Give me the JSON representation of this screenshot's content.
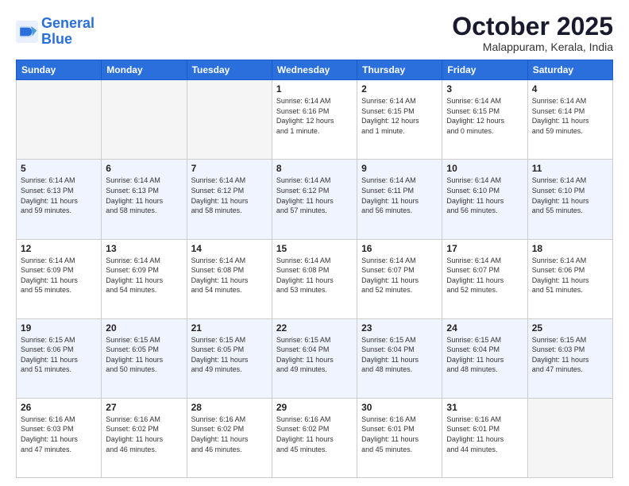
{
  "header": {
    "logo_line1": "General",
    "logo_line2": "Blue",
    "month": "October 2025",
    "location": "Malappuram, Kerala, India"
  },
  "days_of_week": [
    "Sunday",
    "Monday",
    "Tuesday",
    "Wednesday",
    "Thursday",
    "Friday",
    "Saturday"
  ],
  "weeks": [
    [
      {
        "day": "",
        "info": ""
      },
      {
        "day": "",
        "info": ""
      },
      {
        "day": "",
        "info": ""
      },
      {
        "day": "1",
        "info": "Sunrise: 6:14 AM\nSunset: 6:16 PM\nDaylight: 12 hours\nand 1 minute."
      },
      {
        "day": "2",
        "info": "Sunrise: 6:14 AM\nSunset: 6:15 PM\nDaylight: 12 hours\nand 1 minute."
      },
      {
        "day": "3",
        "info": "Sunrise: 6:14 AM\nSunset: 6:15 PM\nDaylight: 12 hours\nand 0 minutes."
      },
      {
        "day": "4",
        "info": "Sunrise: 6:14 AM\nSunset: 6:14 PM\nDaylight: 11 hours\nand 59 minutes."
      }
    ],
    [
      {
        "day": "5",
        "info": "Sunrise: 6:14 AM\nSunset: 6:13 PM\nDaylight: 11 hours\nand 59 minutes."
      },
      {
        "day": "6",
        "info": "Sunrise: 6:14 AM\nSunset: 6:13 PM\nDaylight: 11 hours\nand 58 minutes."
      },
      {
        "day": "7",
        "info": "Sunrise: 6:14 AM\nSunset: 6:12 PM\nDaylight: 11 hours\nand 58 minutes."
      },
      {
        "day": "8",
        "info": "Sunrise: 6:14 AM\nSunset: 6:12 PM\nDaylight: 11 hours\nand 57 minutes."
      },
      {
        "day": "9",
        "info": "Sunrise: 6:14 AM\nSunset: 6:11 PM\nDaylight: 11 hours\nand 56 minutes."
      },
      {
        "day": "10",
        "info": "Sunrise: 6:14 AM\nSunset: 6:10 PM\nDaylight: 11 hours\nand 56 minutes."
      },
      {
        "day": "11",
        "info": "Sunrise: 6:14 AM\nSunset: 6:10 PM\nDaylight: 11 hours\nand 55 minutes."
      }
    ],
    [
      {
        "day": "12",
        "info": "Sunrise: 6:14 AM\nSunset: 6:09 PM\nDaylight: 11 hours\nand 55 minutes."
      },
      {
        "day": "13",
        "info": "Sunrise: 6:14 AM\nSunset: 6:09 PM\nDaylight: 11 hours\nand 54 minutes."
      },
      {
        "day": "14",
        "info": "Sunrise: 6:14 AM\nSunset: 6:08 PM\nDaylight: 11 hours\nand 54 minutes."
      },
      {
        "day": "15",
        "info": "Sunrise: 6:14 AM\nSunset: 6:08 PM\nDaylight: 11 hours\nand 53 minutes."
      },
      {
        "day": "16",
        "info": "Sunrise: 6:14 AM\nSunset: 6:07 PM\nDaylight: 11 hours\nand 52 minutes."
      },
      {
        "day": "17",
        "info": "Sunrise: 6:14 AM\nSunset: 6:07 PM\nDaylight: 11 hours\nand 52 minutes."
      },
      {
        "day": "18",
        "info": "Sunrise: 6:14 AM\nSunset: 6:06 PM\nDaylight: 11 hours\nand 51 minutes."
      }
    ],
    [
      {
        "day": "19",
        "info": "Sunrise: 6:15 AM\nSunset: 6:06 PM\nDaylight: 11 hours\nand 51 minutes."
      },
      {
        "day": "20",
        "info": "Sunrise: 6:15 AM\nSunset: 6:05 PM\nDaylight: 11 hours\nand 50 minutes."
      },
      {
        "day": "21",
        "info": "Sunrise: 6:15 AM\nSunset: 6:05 PM\nDaylight: 11 hours\nand 49 minutes."
      },
      {
        "day": "22",
        "info": "Sunrise: 6:15 AM\nSunset: 6:04 PM\nDaylight: 11 hours\nand 49 minutes."
      },
      {
        "day": "23",
        "info": "Sunrise: 6:15 AM\nSunset: 6:04 PM\nDaylight: 11 hours\nand 48 minutes."
      },
      {
        "day": "24",
        "info": "Sunrise: 6:15 AM\nSunset: 6:04 PM\nDaylight: 11 hours\nand 48 minutes."
      },
      {
        "day": "25",
        "info": "Sunrise: 6:15 AM\nSunset: 6:03 PM\nDaylight: 11 hours\nand 47 minutes."
      }
    ],
    [
      {
        "day": "26",
        "info": "Sunrise: 6:16 AM\nSunset: 6:03 PM\nDaylight: 11 hours\nand 47 minutes."
      },
      {
        "day": "27",
        "info": "Sunrise: 6:16 AM\nSunset: 6:02 PM\nDaylight: 11 hours\nand 46 minutes."
      },
      {
        "day": "28",
        "info": "Sunrise: 6:16 AM\nSunset: 6:02 PM\nDaylight: 11 hours\nand 46 minutes."
      },
      {
        "day": "29",
        "info": "Sunrise: 6:16 AM\nSunset: 6:02 PM\nDaylight: 11 hours\nand 45 minutes."
      },
      {
        "day": "30",
        "info": "Sunrise: 6:16 AM\nSunset: 6:01 PM\nDaylight: 11 hours\nand 45 minutes."
      },
      {
        "day": "31",
        "info": "Sunrise: 6:16 AM\nSunset: 6:01 PM\nDaylight: 11 hours\nand 44 minutes."
      },
      {
        "day": "",
        "info": ""
      }
    ]
  ]
}
